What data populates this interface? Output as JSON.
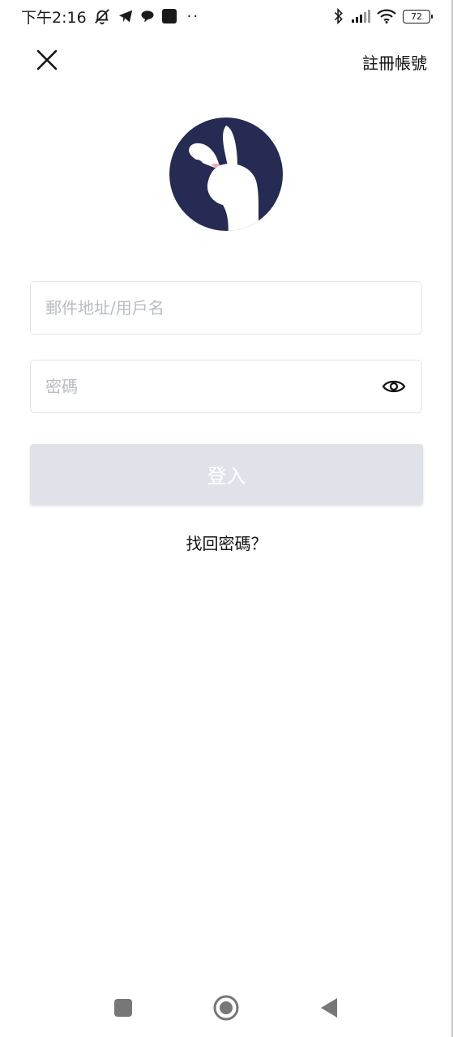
{
  "status_bar": {
    "time": "下午2:16",
    "dots": "··",
    "battery_level": "72"
  },
  "header": {
    "register_label": "註冊帳號"
  },
  "form": {
    "username_placeholder": "郵件地址/用戶名",
    "username_value": "",
    "password_placeholder": "密碼",
    "password_value": "",
    "login_label": "登入",
    "forgot_label": "找回密碼？"
  },
  "colors": {
    "logo_background": "#252b52",
    "button_disabled": "#dfe3e9",
    "field_border": "#e2e4e8",
    "placeholder": "#b9bcc2"
  },
  "icons": {
    "close": "close-icon",
    "eye": "eye-icon",
    "logo": "rabbit-logo-icon",
    "nav_recents": "square-icon",
    "nav_home": "circle-icon",
    "nav_back": "triangle-back-icon"
  }
}
